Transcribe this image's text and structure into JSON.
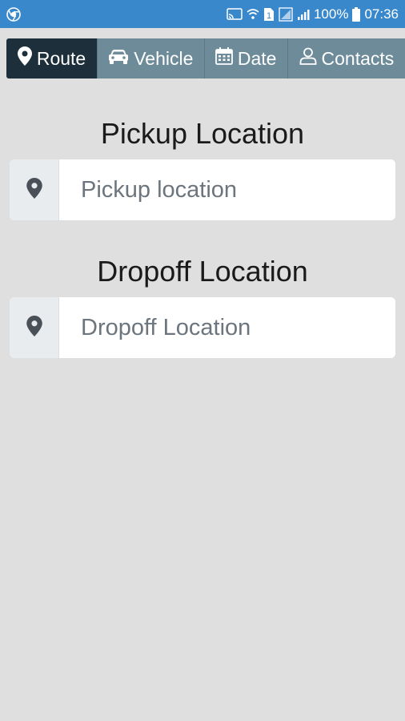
{
  "status_bar": {
    "battery": "100%",
    "time": "07:36",
    "sim_badge": "1",
    "icons": [
      "chrome-icon",
      "cast-icon",
      "wifi-icon",
      "sim-icon",
      "signal-icon",
      "battery-icon"
    ]
  },
  "tabs": [
    {
      "label": "Route",
      "icon": "map-marker-icon",
      "active": true
    },
    {
      "label": "Vehicle",
      "icon": "car-icon",
      "active": false
    },
    {
      "label": "Date",
      "icon": "calendar-icon",
      "active": false
    },
    {
      "label": "Contacts",
      "icon": "user-icon",
      "active": false
    }
  ],
  "pickup": {
    "title": "Pickup Location",
    "placeholder": "Pickup location"
  },
  "dropoff": {
    "title": "Dropoff Location",
    "placeholder": "Dropoff Location"
  },
  "colors": {
    "status_bar": "#3a88cc",
    "tab_active": "#1c2f3a",
    "tab_inactive": "#6d8b99",
    "background": "#dfdfdf"
  }
}
